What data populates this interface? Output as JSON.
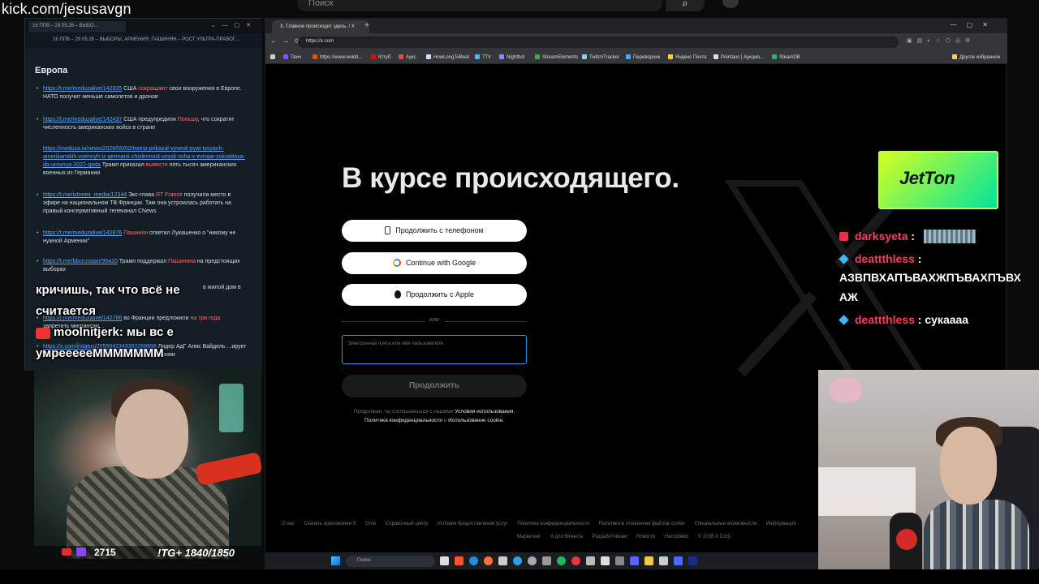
{
  "stream": {
    "url": "kick.com/jesusavgn"
  },
  "topbar": {
    "search_placeholder": "Поиск"
  },
  "left_browser": {
    "tab_title": "16 ППВ – 29.05.26 – ВЫБО...",
    "address": "16 ППВ – 29.05.26 – ВЫБОРЫ, АРМЕНИЯ, ПАШИНЯН – РОСТ УЛЬТРА-ПРАВОГ...",
    "heading": "Европа",
    "items": [
      {
        "link": "https://t.me/meduzalive/142835",
        "pre": " США ",
        "hl": "сокращают",
        "post": " свои вооружения в Европе. НАТО получит меньше самолетов и дронов"
      },
      {
        "link": "https://t.me/meduzalive/142437",
        "pre": " США предупредили ",
        "hl": "Польшу",
        "post": ", что сократят численность американских войск в стране"
      },
      {
        "link": "https://meduza.io/news/2026/05/02/tramp-prikazal-vyvesti-pyat-tysyach-amerikanskih-voennyh-iz-germanii-chislennost-voysk-ssha-v-evrope-sokratitsya-do-urovnya-2022-goda",
        "pre": " Трамп приказал ",
        "hl": "вывести",
        "post": " пять тысяч американских военных из Германии"
      },
      {
        "link": "https://t.me/istories_media/12344",
        "pre": " Экс-глава ",
        "hl": "RT France",
        "post": " получила место в эфире на национальном ТВ Франции. Там она устроилась работать на правый консервативный телеканал CNews"
      },
      {
        "link": "https://t.me/meduzalive/142876",
        "pre": " ",
        "hl": "Пашинян",
        "post": " ответил Лукашенко о \"никому не нужной Армении\""
      },
      {
        "link": "https://t.me/bbcrussian/95420",
        "pre": " Трамп поддержал ",
        "hl": "Пашиняна",
        "post": " на предстоящих выборах"
      },
      {
        "link": "https://t.me/meduzalive/142766",
        "pre": " во Франции предложили ",
        "hl": "на три года",
        "post": " запретить мигрантам..."
      },
      {
        "link": "https://x.com/i/status/2055642343392268898",
        "pre": " Лидер АдГ Алис Вайдель ",
        "hl": "",
        "post": "...ирует \"медведя\", что может стать угрозой для Германии"
      }
    ]
  },
  "left_overlay_chat": {
    "line1": "кричишь, так что всё не",
    "line2": "считается",
    "user": "moolnitjerk",
    "msg1": ": мы вс е",
    "msg2": "умреееееМММММММ",
    "fragment": "в жилой дом в"
  },
  "left_cam": {
    "viewers": "2715",
    "goal": "!TG+ 1840/1850"
  },
  "main_browser": {
    "tab_title": "X. Главное происходит здесь. / X",
    "url": "https://x.com",
    "bookmarks": [
      "Твич",
      "https://www.reddit...",
      "Ютуб",
      "Аукс",
      "HowLongToBeat",
      "7TV",
      "Nightbot",
      "StreamElements",
      "TwitchTracker",
      "Переводчик",
      "Яндекс Почта",
      "Pointauc | Аукцио...",
      "SteamDB"
    ],
    "bookmarks_other": "Другое избранное"
  },
  "x_page": {
    "headline": "В курсе происходящего.",
    "btn_phone": "Продолжить с телефоном",
    "btn_google": "Continue with Google",
    "btn_apple": "Продолжить с Apple",
    "or": "или",
    "email_placeholder": "Электронная почта или имя пользователя",
    "continue": "Продолжить",
    "terms_pre": "Продолжая, ты соглашаешься с нашими ",
    "terms_link": "Условия использования.",
    "privacy": "Политика конфиденциальности",
    "and": " и ",
    "cookie": "Использование cookie.",
    "footer_row1": [
      "О нас",
      "Скачать приложение X",
      "Grok",
      "Справочный центр",
      "Условия предоставления услуг",
      "Политика конфиденциальности",
      "Политика в отношении файлов cookie",
      "Специальные возможности",
      "Информация"
    ],
    "footer_row2": [
      "Маркетинг",
      "X для бизнеса",
      "Разработчикам",
      "Новости",
      "Настройки",
      "© 2026 X Corp."
    ]
  },
  "taskbar": {
    "search_label": "Поиск"
  },
  "right_overlay": {
    "sponsor": "JetTon",
    "chat": [
      {
        "user": "darksyeta",
        "msg": " :"
      },
      {
        "user": "deattthless",
        "msg": " :"
      },
      {
        "user": "",
        "msg": "АЗВПВХАПЪВАХЖПЪВАХПЪВХ"
      },
      {
        "user": "",
        "msg": "АЖ"
      },
      {
        "user": "deattthless",
        "msg": " : сукаааа"
      }
    ]
  },
  "colors": {
    "x_blue": "#1d9bf0",
    "chat_name": "#ff3c5c",
    "link_blue": "#5ba7ff",
    "highlight_red": "#ff6a6a",
    "jetton_green": "#d6ff20"
  }
}
